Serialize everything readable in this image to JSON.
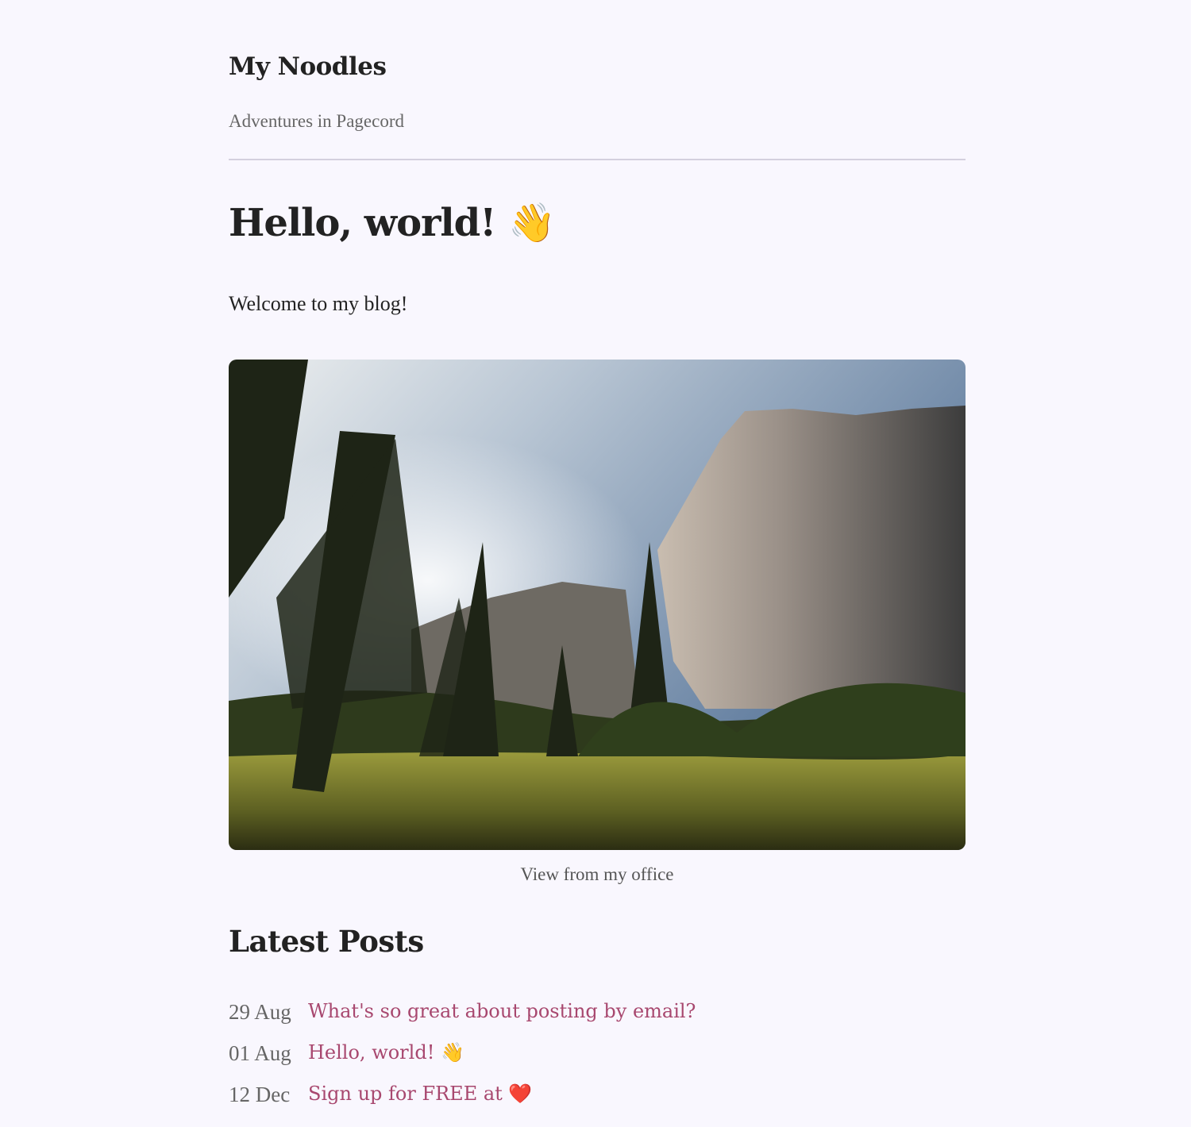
{
  "header": {
    "title": "My Noodles",
    "subtitle": "Adventures in Pagecord"
  },
  "post": {
    "title": "Hello, world! 👋",
    "body": "Welcome to my blog!",
    "image_caption": "View from my office"
  },
  "latest": {
    "heading": "Latest Posts",
    "items": [
      {
        "date": "29 Aug",
        "title": "What's so great about posting by email?"
      },
      {
        "date": "01 Aug",
        "title": "Hello, world! 👋"
      },
      {
        "date": "12 Dec",
        "title": "Sign up for FREE at ❤️"
      }
    ]
  },
  "colors": {
    "background": "#f9f7fe",
    "link": "#a8486f",
    "text": "#222222",
    "muted": "#666666"
  }
}
